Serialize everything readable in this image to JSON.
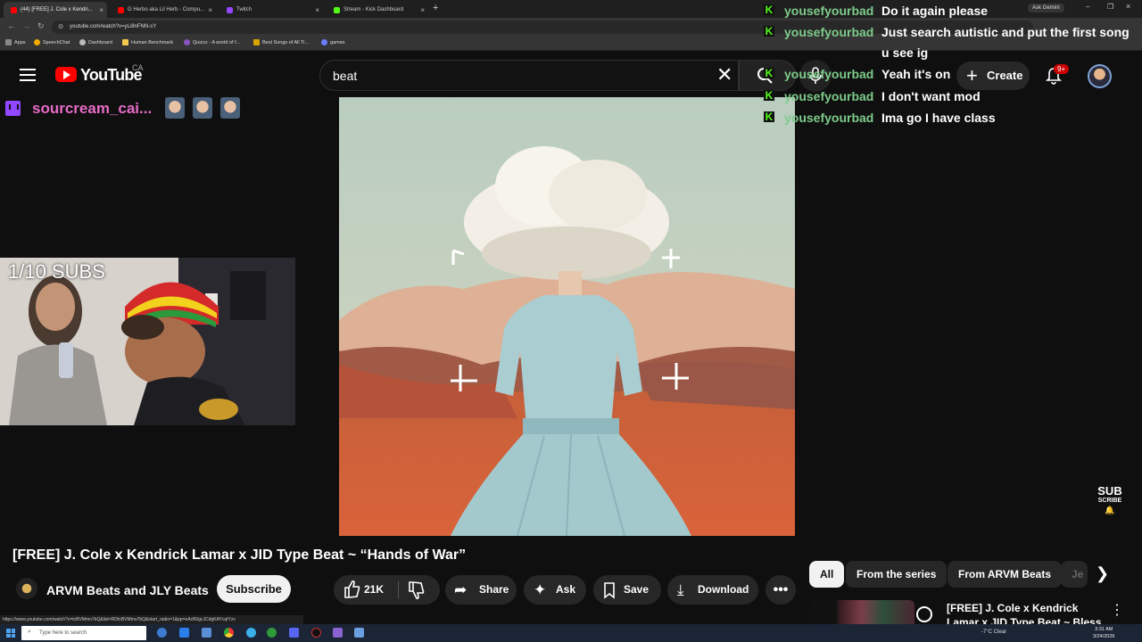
{
  "browser": {
    "tabs": [
      {
        "label": "(44) [FREE] J. Cole x Kendri...",
        "active": true
      },
      {
        "label": "G Herbo aka Lil Herb - Compu...",
        "active": false
      },
      {
        "label": "Twitch",
        "active": false
      },
      {
        "label": "Stream - Kick Dashboard",
        "active": false
      }
    ],
    "new_tab": "+",
    "ask_gemini": "Ask Gemini",
    "url": "youtube.com/watch?v=yLi8nFNN-sY",
    "bookmarks": [
      "Apps",
      "SpeechChat",
      "Dashboard",
      "Human Benchmark",
      "Quizzz - A world of f...",
      "Best Songs of All Ti...",
      "games"
    ],
    "status_url": "https://www.youtube.com/watch?v=tcBVMmo7bQ&list=RDtcBVMmo7bQ&start_radio=1&pp=oAcB0gcJCdgKAYcqIYzv"
  },
  "youtube": {
    "wordmark": "YouTube",
    "country": "CA",
    "search_value": "beat",
    "create_label": "Create",
    "notification_count": "9+"
  },
  "stream_overlay": {
    "streamer_name": "sourcream_cai...",
    "sub_goal": "1/10 SUBS",
    "sub_overlay_line1": "SUB",
    "sub_overlay_line2": "SCRIBE"
  },
  "chat": [
    {
      "user": "yousefyourbad",
      "message": "Do it again please"
    },
    {
      "user": "yousefyourbad",
      "message": "Just search autistic and put the first song"
    },
    {
      "user": "",
      "message": "u see ig"
    },
    {
      "user": "yousefyourbad",
      "message": "Yeah it's on"
    },
    {
      "user": "yousefyourbad",
      "message": "I don't want mod"
    },
    {
      "user": "yousefyourbad",
      "message": "Ima go I have class"
    }
  ],
  "video": {
    "title": "[FREE] J. Cole x Kendrick Lamar x JID Type Beat ~ “Hands of War”",
    "channel": "ARVM Beats and JLY Beats",
    "subscribe_label": "Subscribe",
    "likes": "21K",
    "share_label": "Share",
    "ask_label": "Ask",
    "save_label": "Save",
    "download_label": "Download"
  },
  "related": {
    "chips": [
      "All",
      "From the series",
      "From ARVM Beats",
      "Je"
    ],
    "first_title": "[FREE] J. Cole x Kendrick Lamar x JID Type Beat ~ Bless Your"
  },
  "taskbar": {
    "search_placeholder": "Type here to search",
    "weather": "-7°C  Clear",
    "time": "3:31 AM",
    "date": "3/24/2026"
  }
}
